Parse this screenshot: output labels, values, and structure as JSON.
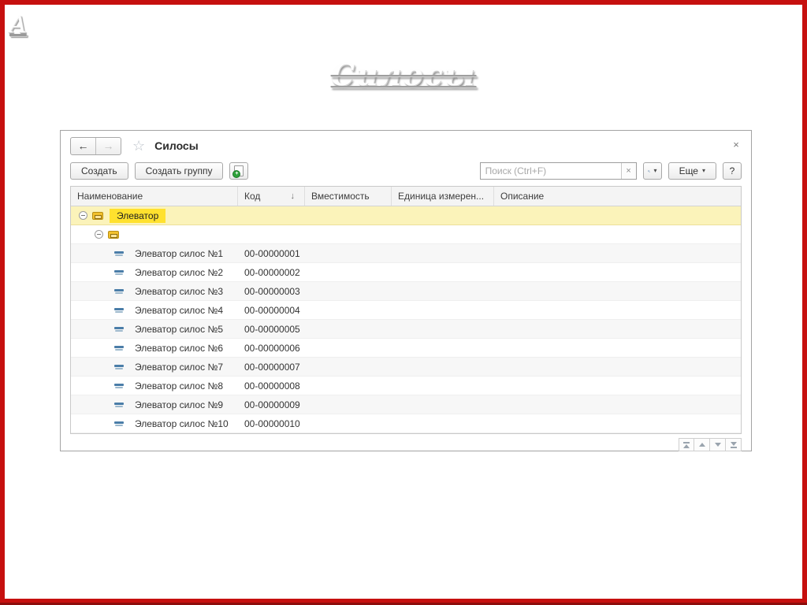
{
  "slide": {
    "corner_letter": "A",
    "title": "Силосы"
  },
  "window": {
    "title": "Силосы",
    "icons": {
      "back_arrow": "←",
      "forward_arrow": "→",
      "star": "☆",
      "close": "×",
      "more_caret": "▾",
      "search_caret": "▾",
      "clear": "×",
      "copy_plus": "+"
    },
    "toolbar": {
      "create_label": "Создать",
      "create_group_label": "Создать группу",
      "more_label": "Еще",
      "help_label": "?",
      "search_placeholder": "Поиск (Ctrl+F)",
      "search_value": ""
    },
    "table": {
      "columns": [
        {
          "label": "Наименование",
          "sort": ""
        },
        {
          "label": "Код",
          "sort": "↓"
        },
        {
          "label": "Вместимость",
          "sort": ""
        },
        {
          "label": "Единица измерен...",
          "sort": ""
        },
        {
          "label": "Описание",
          "sort": ""
        }
      ],
      "rows": [
        {
          "type": "group",
          "level": 0,
          "name": "Элеватор",
          "code": "",
          "capacity": "",
          "unit": "",
          "description": "",
          "selected": true
        },
        {
          "type": "group",
          "level": 1,
          "name": "",
          "code": "",
          "capacity": "",
          "unit": "",
          "description": "",
          "selected": false
        },
        {
          "type": "item",
          "level": 2,
          "name": "Элеватор силос №1",
          "code": "00-00000001",
          "capacity": "",
          "unit": "",
          "description": "",
          "selected": false
        },
        {
          "type": "item",
          "level": 2,
          "name": "Элеватор силос №2",
          "code": "00-00000002",
          "capacity": "",
          "unit": "",
          "description": "",
          "selected": false
        },
        {
          "type": "item",
          "level": 2,
          "name": "Элеватор силос №3",
          "code": "00-00000003",
          "capacity": "",
          "unit": "",
          "description": "",
          "selected": false
        },
        {
          "type": "item",
          "level": 2,
          "name": "Элеватор силос №4",
          "code": "00-00000004",
          "capacity": "",
          "unit": "",
          "description": "",
          "selected": false
        },
        {
          "type": "item",
          "level": 2,
          "name": "Элеватор силос №5",
          "code": "00-00000005",
          "capacity": "",
          "unit": "",
          "description": "",
          "selected": false
        },
        {
          "type": "item",
          "level": 2,
          "name": "Элеватор силос №6",
          "code": "00-00000006",
          "capacity": "",
          "unit": "",
          "description": "",
          "selected": false
        },
        {
          "type": "item",
          "level": 2,
          "name": "Элеватор силос №7",
          "code": "00-00000007",
          "capacity": "",
          "unit": "",
          "description": "",
          "selected": false
        },
        {
          "type": "item",
          "level": 2,
          "name": "Элеватор силос №8",
          "code": "00-00000008",
          "capacity": "",
          "unit": "",
          "description": "",
          "selected": false
        },
        {
          "type": "item",
          "level": 2,
          "name": "Элеватор силос №9",
          "code": "00-00000009",
          "capacity": "",
          "unit": "",
          "description": "",
          "selected": false
        },
        {
          "type": "item",
          "level": 2,
          "name": "Элеватор силос №10",
          "code": "00-00000010",
          "capacity": "",
          "unit": "",
          "description": "",
          "selected": false
        }
      ]
    },
    "footer_buttons": [
      {
        "name": "go-to-first-button",
        "icon": "bar-up"
      },
      {
        "name": "move-up-button",
        "icon": "up"
      },
      {
        "name": "move-down-button",
        "icon": "down"
      },
      {
        "name": "go-to-last-button",
        "icon": "bar-down"
      }
    ]
  }
}
